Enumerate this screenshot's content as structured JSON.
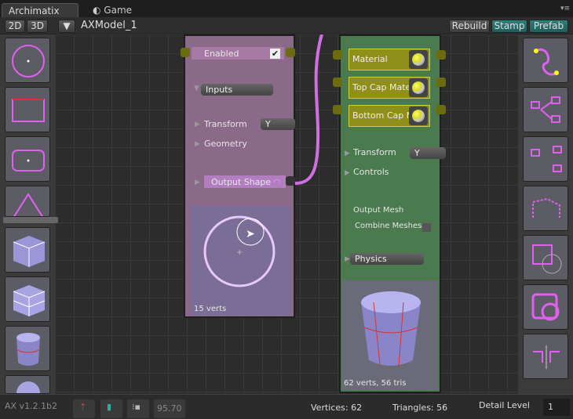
{
  "tabs": {
    "archimatix": "Archimatix",
    "game": "Game"
  },
  "toolbar": {
    "btn_2d": "2D",
    "btn_3d": "3D",
    "model_name": "AXModel_1",
    "rebuild": "Rebuild",
    "stamp": "Stamp",
    "prefab": "Prefab"
  },
  "shape_node": {
    "enabled_label": "Enabled",
    "enabled": true,
    "inputs": "Inputs",
    "transform": "Transform",
    "transform_axis": "Y",
    "geometry": "Geometry",
    "output_shape": "Output Shape",
    "preview_stats": "15 verts"
  },
  "mesh_node": {
    "materials": [
      "Material",
      "Top Cap Mate",
      "Bottom Cap M"
    ],
    "transform": "Transform",
    "transform_axis": "Y",
    "controls": "Controls",
    "output_mesh": "Output Mesh",
    "combine_meshes": "Combine Meshes",
    "physics": "Physics",
    "preview_stats": "62 verts, 56 tris"
  },
  "status": {
    "version": "AX v1.2.1b2",
    "zoom": "95.70",
    "vertices": "Vertices: 62",
    "triangles": "Triangles: 56",
    "detail_label": "Detail Level",
    "detail_value": "1"
  },
  "colors": {
    "shape_node": "#8a6a88",
    "mesh_node": "#4a7a4e",
    "wire": "#d070e0",
    "accent_teal": "#2f7f7a"
  }
}
